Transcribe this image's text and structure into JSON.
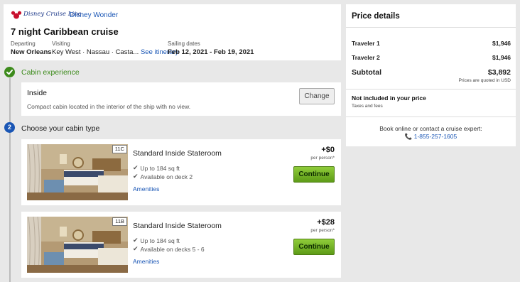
{
  "header": {
    "brand": "Disney Cruise Line",
    "ship": "Disney Wonder",
    "title": "7 night Caribbean cruise",
    "departing_label": "Departing",
    "departing_value": "New Orleans",
    "visiting_label": "Visiting",
    "visiting_value": "Key West · Nassau · Casta...",
    "see_itinerary": "See itinerary",
    "sailing_label": "Sailing dates",
    "sailing_value": "Feb 12, 2021 - Feb 19, 2021"
  },
  "steps": {
    "step1_title": "Cabin experience",
    "step2_number": "2",
    "step2_title": "Choose your cabin type"
  },
  "cabin_experience": {
    "name": "Inside",
    "description": "Compact cabin located in the interior of the ship with no view.",
    "change_label": "Change"
  },
  "cabins": [
    {
      "badge": "11C",
      "name": "Standard Inside Stateroom",
      "size": "Up to 184 sq ft",
      "deck": "Available on deck 2",
      "amenities": "Amenities",
      "price": "+$0",
      "per_person": "per person*",
      "continue": "Continue"
    },
    {
      "badge": "11B",
      "name": "Standard Inside Stateroom",
      "size": "Up to 184 sq ft",
      "deck": "Available on decks 5 - 6",
      "amenities": "Amenities",
      "price": "+$28",
      "per_person": "per person*",
      "continue": "Continue"
    }
  ],
  "price_details": {
    "title": "Price details",
    "traveler1_label": "Traveler 1",
    "traveler1_value": "$1,946",
    "traveler2_label": "Traveler 2",
    "traveler2_value": "$1,946",
    "subtotal_label": "Subtotal",
    "subtotal_value": "$3,892",
    "quoted_note": "Prices are quoted in USD",
    "not_included_title": "Not included in your price",
    "not_included_sub": "Taxes and fees",
    "book_text": "Book online or contact a cruise expert:",
    "phone": "1-855-257-1605"
  },
  "colors": {
    "accent_blue": "#1a56b5",
    "success_green": "#3d8b1c",
    "continue_green": "#6fab22"
  },
  "icons": [
    "mickey-logo-icon",
    "check-circle-icon",
    "check-icon",
    "phone-icon"
  ]
}
